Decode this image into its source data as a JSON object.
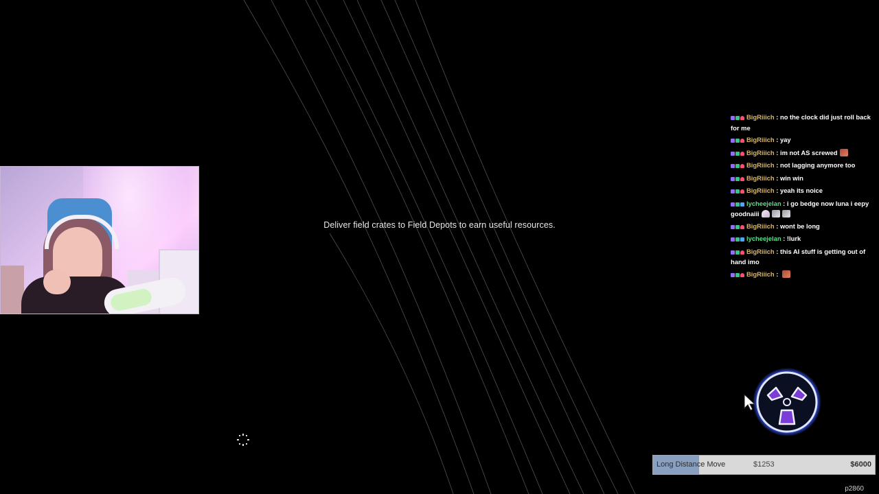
{
  "objective": {
    "text": "Deliver field crates to Field Depots to earn useful resources."
  },
  "chat": {
    "messages": [
      {
        "user": "BigRiiich",
        "user_color": "#d9b86a",
        "separator": " : ",
        "text": "no the clock did just roll back for me",
        "emote": ""
      },
      {
        "user": "BigRiiich",
        "user_color": "#d9b86a",
        "separator": " : ",
        "text": "yay",
        "emote": ""
      },
      {
        "user": "BigRiiich",
        "user_color": "#d9b86a",
        "separator": " : ",
        "text": "im not AS screwed",
        "emote": "red-emote"
      },
      {
        "user": "BigRiiich",
        "user_color": "#d9b86a",
        "separator": " : ",
        "text": "not lagging anymore too",
        "emote": ""
      },
      {
        "user": "BigRiiich",
        "user_color": "#d9b86a",
        "separator": " : ",
        "text": "win win",
        "emote": ""
      },
      {
        "user": "BigRiiich",
        "user_color": "#d9b86a",
        "separator": " : ",
        "text": "yeah its noice",
        "emote": ""
      },
      {
        "user": "lycheejelan",
        "user_color": "#55e089",
        "separator": " : ",
        "text": "i go bedge now luna i eepy goodnaiii",
        "emote": "ghost-emotes"
      },
      {
        "user": "BigRiiich",
        "user_color": "#d9b86a",
        "separator": " : ",
        "text": "wont be long",
        "emote": ""
      },
      {
        "user": "lycheejelan",
        "user_color": "#55e089",
        "separator": " : ",
        "text": "!lurk",
        "emote": ""
      },
      {
        "user": "BigRiiich",
        "user_color": "#d9b86a",
        "separator": " : ",
        "text": "this AI stuff is getting out of hand imo",
        "emote": ""
      },
      {
        "user": "BigRiiich",
        "user_color": "#d9b86a",
        "separator": " : ",
        "text": "",
        "emote": "red-emote"
      }
    ]
  },
  "job": {
    "name": "Long Distance Move",
    "current": "$1253",
    "target": "$6000",
    "progress": 0.2088
  },
  "frame_label": "p2860",
  "colors": {
    "background": "#000000",
    "wheel_glow": "#3b5cff",
    "progress_fill": "#8aa0c0"
  },
  "icons": {
    "reticle": "dotted-circle-reticle-icon",
    "wheel": "radial-tri-segment-wheel-icon",
    "cursor": "mouse-pointer-icon"
  }
}
